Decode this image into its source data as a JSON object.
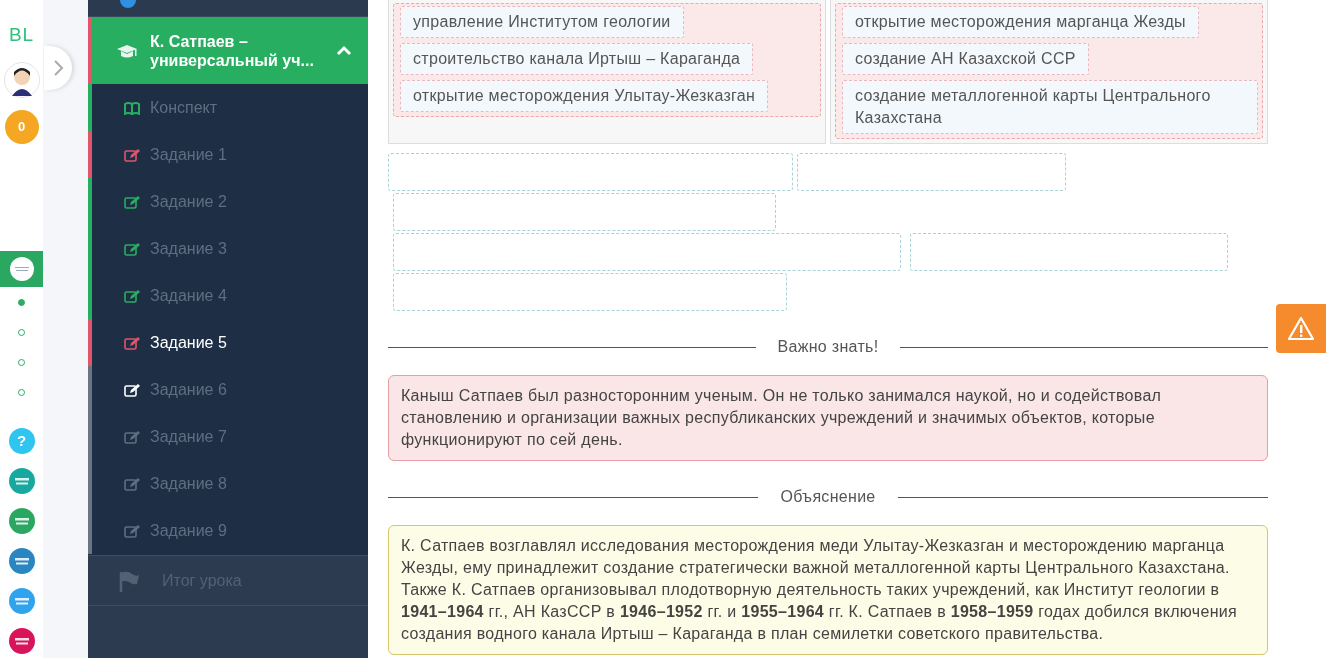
{
  "rail": {
    "logo": "BL",
    "score": "0",
    "steps": [
      {
        "done": true
      },
      {
        "done": false
      },
      {
        "done": false
      },
      {
        "done": false
      }
    ],
    "apps": [
      {
        "kind": "help",
        "label": "?",
        "color": "#2ec5f0"
      },
      {
        "kind": "logo",
        "color": "#17a9a0"
      },
      {
        "kind": "logo",
        "color": "#2aa862"
      },
      {
        "kind": "logo",
        "color": "#2a86c0"
      },
      {
        "kind": "logo",
        "color": "#2fa3ee"
      },
      {
        "kind": "logo",
        "color": "#d8145a"
      }
    ]
  },
  "sidebar": {
    "lesson": {
      "title": "К. Сатпаев – универсальный уч...",
      "expanded": true,
      "color": "#e0556b"
    },
    "items": [
      {
        "label": "Конспект",
        "kind": "notes",
        "color": "#27ae60",
        "done": true,
        "selected": false
      },
      {
        "label": "Задание 1",
        "kind": "task",
        "color": "#e0556b",
        "done": true,
        "selected": false
      },
      {
        "label": "Задание 2",
        "kind": "task",
        "color": "#27ae60",
        "done": true,
        "selected": false
      },
      {
        "label": "Задание 3",
        "kind": "task",
        "color": "#27ae60",
        "done": true,
        "selected": false
      },
      {
        "label": "Задание 4",
        "kind": "task",
        "color": "#27ae60",
        "done": true,
        "selected": false
      },
      {
        "label": "Задание 5",
        "kind": "task",
        "color": "#e0556b",
        "done": true,
        "selected": true
      },
      {
        "label": "Задание 6",
        "kind": "task",
        "color": "#ffffff",
        "done": false,
        "selected": false
      },
      {
        "label": "Задание 7",
        "kind": "task",
        "color": "#5f6e80",
        "done": false,
        "selected": false
      },
      {
        "label": "Задание 8",
        "kind": "task",
        "color": "#5f6e80",
        "done": false,
        "selected": false
      },
      {
        "label": "Задание 9",
        "kind": "task",
        "color": "#5f6e80",
        "done": false,
        "selected": false
      }
    ],
    "summary": "Итог урока"
  },
  "matching": {
    "columns": [
      {
        "items": [
          "управление Институтом геологии",
          "строительство канала Иртыш – Караганда",
          "открытие месторождения Улытау-Жезказган"
        ]
      },
      {
        "items": [
          "открытие месторождения марганца Жезды",
          "создание АН Казахской ССР",
          "создание металлогенной карты Центрального Казахстана"
        ]
      }
    ]
  },
  "answer_slots": [
    {
      "filled": false
    },
    {
      "filled": false
    },
    {
      "filled": false
    },
    {
      "filled": false
    },
    {
      "filled": false
    },
    {
      "filled": false
    }
  ],
  "notice": {
    "heading": "Важно знать!",
    "text": "Каныш Сатпаев был разносторонним ученым. Он не только занимался наукой, но и содействовал становлению и организации важных республиканских учреждений и значимых объектов, которые функционируют по сей день."
  },
  "explanation": {
    "heading": "Объяснение",
    "text": "К. Сатпаев возглавлял исследования месторождения меди Улытау-Жезказган и месторождению марганца Жезды, ему принадлежит создание стратегически важной металлогенной карты Центрального Казахстана. Также К. Сатпаев организовывал плодотворную деятельность таких учреждений, как Институт геологии в **1941–1964** гг., АН КазССР в **1946–1952** гг. и **1955–1964** гг. К. Сатпаев в **1958–1959** годах добился включения создания водного канала Иртыш – Караганда в план семилетки советского правительства."
  }
}
